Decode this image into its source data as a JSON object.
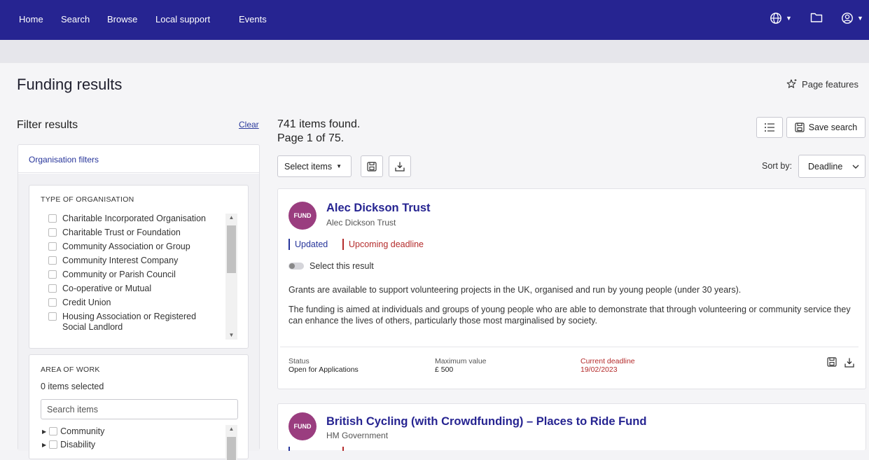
{
  "nav": {
    "items": [
      "Home",
      "Search",
      "Browse",
      "Local support",
      "Events"
    ]
  },
  "page": {
    "title": "Funding results",
    "features_label": "Page features"
  },
  "filters": {
    "title": "Filter results",
    "clear_label": "Clear",
    "org_header": "Organisation filters",
    "type_title": "TYPE OF ORGANISATION",
    "type_options": [
      "Charitable Incorporated Organisation",
      "Charitable Trust or Foundation",
      "Community Association or Group",
      "Community Interest Company",
      "Community or Parish Council",
      "Co-operative or Mutual",
      "Credit Union",
      "Housing Association or Registered Social Landlord"
    ],
    "area_title": "AREA OF WORK",
    "area_selected": "0 items selected",
    "area_search_placeholder": "Search items",
    "area_options": [
      "Community",
      "Disability"
    ]
  },
  "results": {
    "count_line": "741 items found.",
    "page_line": "Page 1 of 75.",
    "select_items_label": "Select items",
    "save_search_label": "Save search",
    "sort_label": "Sort by:",
    "sort_value": "Deadline",
    "badge_text": "FUND",
    "cards": [
      {
        "title": "Alec Dickson Trust",
        "org": "Alec Dickson Trust",
        "tag_updated": "Updated",
        "tag_deadline": "Upcoming deadline",
        "select_label": "Select this result",
        "desc1": "Grants are available to support volunteering projects in the UK, organised and run by young people (under 30 years).",
        "desc2": "The funding is aimed at individuals and groups of young people who are able to demonstrate that through volunteering or community service they can enhance the lives of others, particularly those most marginalised by society.",
        "status_label": "Status",
        "status_value": "Open for Applications",
        "max_label": "Maximum value",
        "max_value": "£ 500",
        "deadline_label": "Current deadline",
        "deadline_value": "19/02/2023"
      },
      {
        "title": "British Cycling (with Crowdfunding) – Places to Ride Fund",
        "org": "HM Government"
      }
    ]
  },
  "colors": {
    "nav_bg": "#262491",
    "accent_blue": "#262491",
    "badge_purple": "#9a3d7f",
    "deadline_red": "#b42b2b"
  }
}
